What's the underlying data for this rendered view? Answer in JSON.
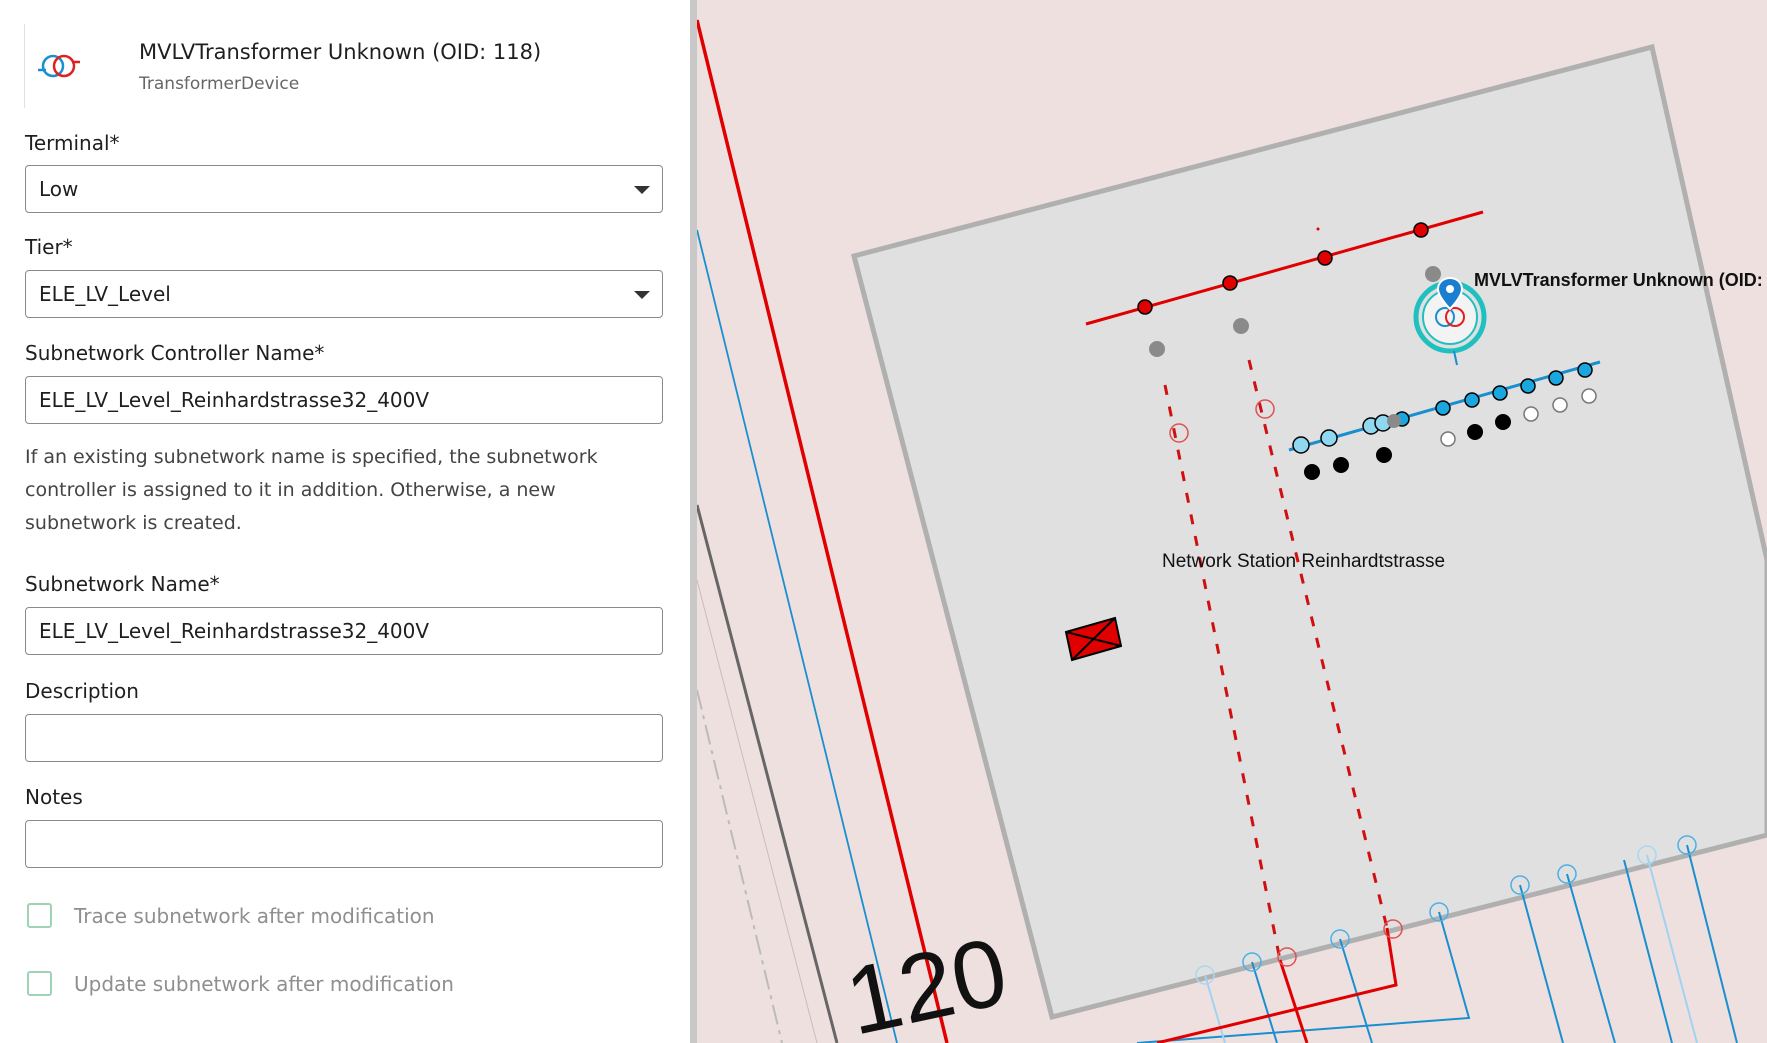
{
  "header": {
    "title": "MVLVTransformer Unknown (OID: 118)",
    "subtitle": "TransformerDevice",
    "icon": "transformer-icon"
  },
  "form": {
    "terminal": {
      "label": "Terminal*",
      "value": "Low"
    },
    "tier": {
      "label": "Tier*",
      "value": "ELE_LV_Level"
    },
    "controller_name": {
      "label": "Subnetwork Controller Name*",
      "value": "ELE_LV_Level_Reinhardstrasse32_400V"
    },
    "help_text": "If an existing subnetwork name is specified, the subnetwork controller is assigned to it in addition. Otherwise, a new subnetwork is created.",
    "subnetwork_name": {
      "label": "Subnetwork Name*",
      "value": "ELE_LV_Level_Reinhardstrasse32_400V"
    },
    "description": {
      "label": "Description",
      "value": ""
    },
    "notes": {
      "label": "Notes",
      "value": ""
    },
    "trace_checkbox": {
      "label": "Trace subnetwork after modification",
      "checked": false
    },
    "update_checkbox": {
      "label": "Update subnetwork after modification",
      "checked": false
    }
  },
  "map": {
    "feature_label": "MVLVTransformer Unknown (OID:",
    "station_label": "Network Station Reinhardtstrasse",
    "parcel_number": "120",
    "colors": {
      "mv_line": "#e00000",
      "lv_line": "#1a8fd0",
      "station_fill": "#e0e0e0",
      "background": "#efe0e0",
      "selection": "#20c0c0"
    }
  }
}
